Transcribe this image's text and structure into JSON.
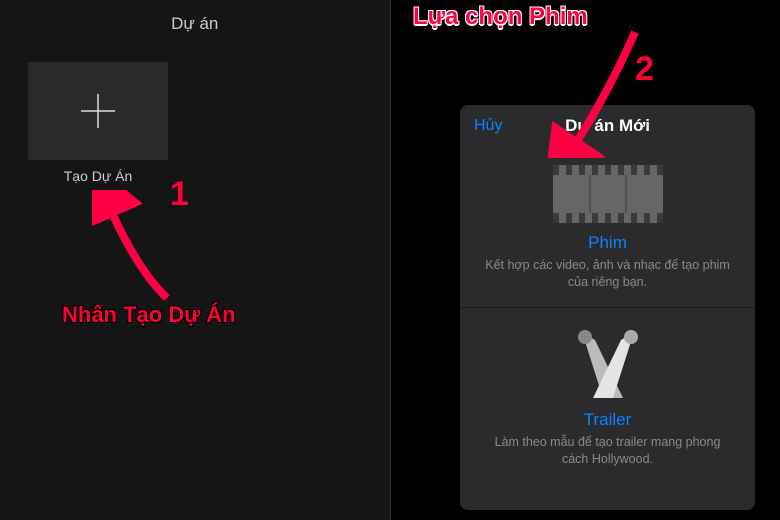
{
  "left": {
    "title": "Dự án",
    "create_label": "Tạo Dự Án"
  },
  "annotations": {
    "step1_num": "1",
    "step1_text": "Nhấn Tạo Dự Án",
    "step2_num": "2",
    "top_text": "Lựa chọn Phim"
  },
  "dialog": {
    "cancel": "Hủy",
    "title": "Dự án Mới",
    "movie": {
      "title": "Phim",
      "desc": "Kết hợp các video, ảnh và nhạc để tạo phim của riêng bạn."
    },
    "trailer": {
      "title": "Trailer",
      "desc": "Làm theo mẫu để tạo trailer mang phong cách Hollywood."
    }
  }
}
